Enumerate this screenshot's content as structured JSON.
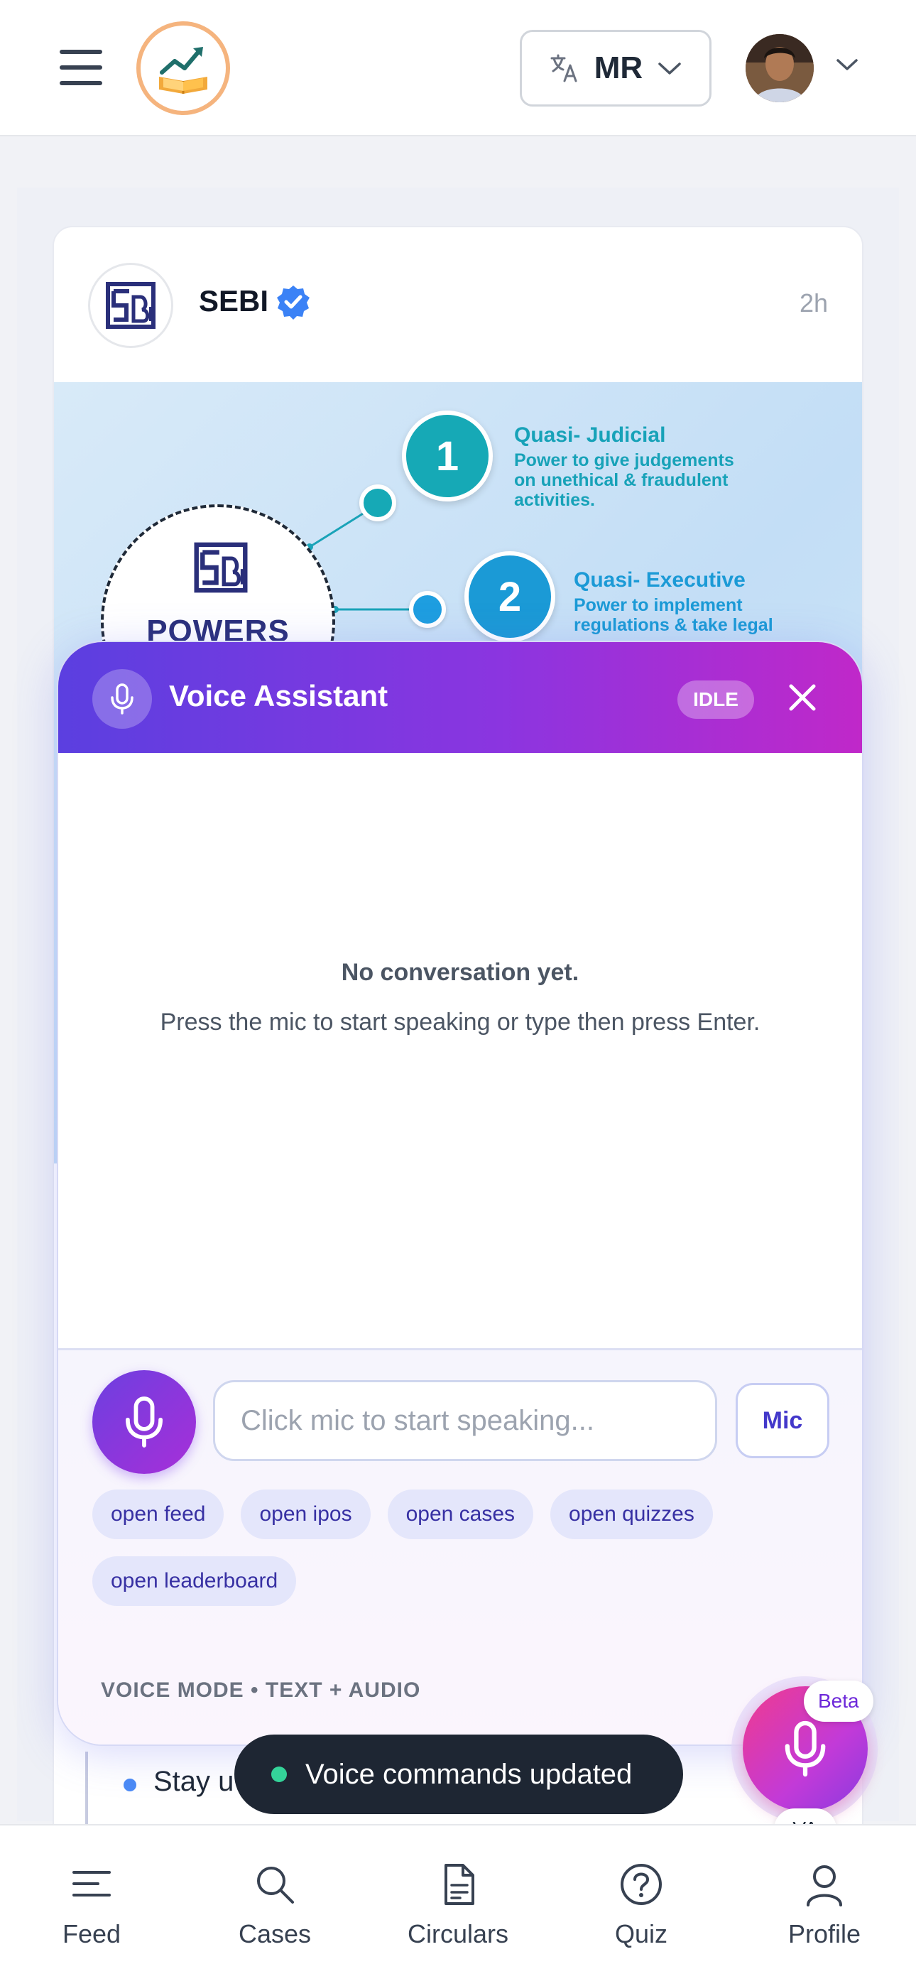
{
  "header": {
    "language": "MR",
    "icons": {
      "menu": "hamburger-menu-icon",
      "translate": "translate-icon",
      "chevron": "chevron-down-icon"
    }
  },
  "post": {
    "author": "SEBI",
    "time": "2h",
    "image": {
      "center_label": "POWERS",
      "items": [
        {
          "number": "1",
          "title": "Quasi- Judicial",
          "desc_lines": [
            "Power to give judgements",
            "on unethical & fraudulent",
            "activities."
          ]
        },
        {
          "number": "2",
          "title": "Quasi- Executive",
          "desc_lines": [
            "Power to implement",
            "regulations & take legal"
          ]
        }
      ]
    },
    "bullet_text": "Stay u"
  },
  "voice_assistant": {
    "title": "Voice Assistant",
    "status": "IDLE",
    "empty_title": "No conversation yet.",
    "empty_subtitle": "Press the mic to start speaking or type then press Enter.",
    "input_placeholder": "Click mic to start speaking...",
    "mic_button": "Mic",
    "chips": [
      "open feed",
      "open ipos",
      "open cases",
      "open quizzes",
      "open leaderboard"
    ],
    "mode": "VOICE MODE • TEXT + AUDIO",
    "accent_start": "#5b3fe0",
    "accent_end": "#c028c9"
  },
  "fab": {
    "badge": "Beta",
    "label": "VA"
  },
  "toast": {
    "text": "Voice commands updated",
    "dot_color": "#34d399"
  },
  "bottom_nav": {
    "items": [
      {
        "label": "Feed",
        "icon": "feed-lines-icon"
      },
      {
        "label": "Cases",
        "icon": "search-icon"
      },
      {
        "label": "Circulars",
        "icon": "document-icon"
      },
      {
        "label": "Quiz",
        "icon": "question-circle-icon"
      },
      {
        "label": "Profile",
        "icon": "user-icon"
      }
    ]
  }
}
